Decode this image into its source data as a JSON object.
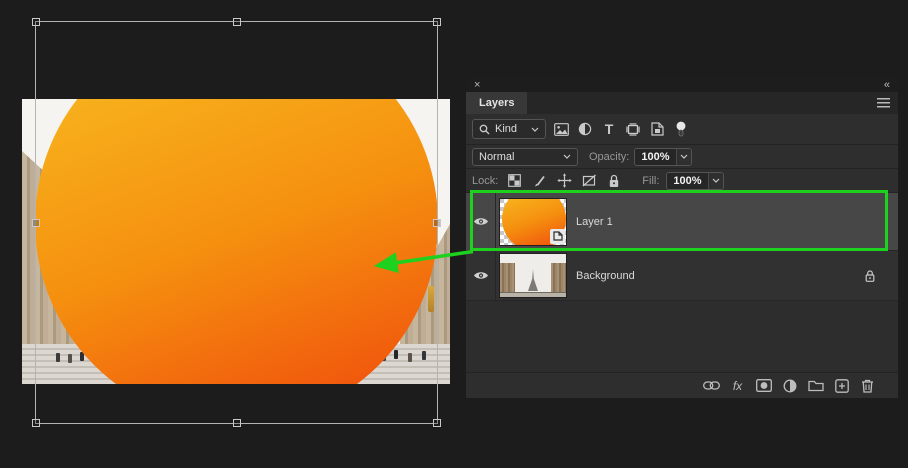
{
  "colors": {
    "accent_green": "#1fd11f",
    "gradient_top": "#f8bb21",
    "gradient_bottom": "#ef450c",
    "panel_bg": "#2e2e2e",
    "selected_row_bg": "#474747"
  },
  "panel": {
    "close_icon": "×",
    "collapse_icon": "«",
    "title_tab": "Layers",
    "filter_row": {
      "kind_label": "Kind",
      "icon_names": [
        "search-icon",
        "image-filter-icon",
        "adjustment-filter-icon",
        "type-filter-icon",
        "shape-filter-icon",
        "smart-object-filter-icon",
        "filter-toggle-pin"
      ]
    },
    "blend_row": {
      "blend_mode": "Normal",
      "opacity_label": "Opacity:",
      "opacity_value": "100%"
    },
    "lock_row": {
      "lock_label": "Lock:",
      "icon_names": [
        "lock-transparency-icon",
        "lock-paint-icon",
        "lock-move-icon",
        "lock-artboard-icon",
        "lock-all-icon"
      ],
      "fill_label": "Fill:",
      "fill_value": "100%"
    },
    "layers": [
      {
        "name": "Layer 1",
        "selected": true,
        "visible": true,
        "badge": "smart-object"
      },
      {
        "name": "Background",
        "selected": false,
        "visible": true,
        "badge": "locked"
      }
    ],
    "footer": {
      "fx_label": "fx",
      "icon_names": [
        "link-icon",
        "fx-icon",
        "layer-mask-icon",
        "adjustment-layer-icon",
        "new-group-icon",
        "new-layer-icon",
        "delete-layer-icon"
      ]
    }
  },
  "annotation": {
    "highlight_target": "Layer 1 row",
    "arrow_target": "orange gradient circle on canvas"
  },
  "canvas": {
    "content": "orange gradient circle over Paris plaza photo",
    "transform_handles": 8
  }
}
